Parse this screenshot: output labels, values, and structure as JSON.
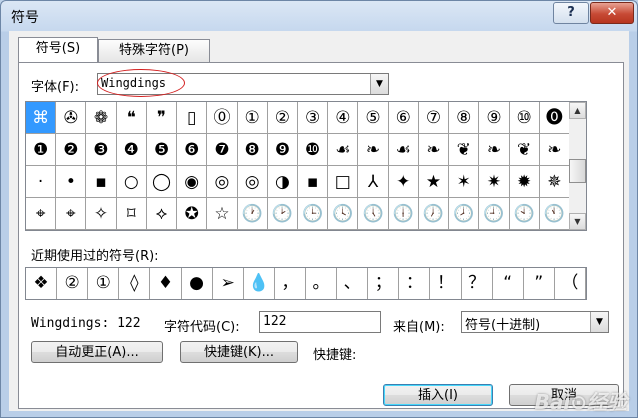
{
  "window": {
    "title": "符号",
    "help_label": "?",
    "close_label": "✕"
  },
  "tabs": [
    {
      "label": "符号(S)"
    },
    {
      "label": "特殊字符(P)"
    }
  ],
  "font_label": "字体(F):",
  "font_value": "Wingdings",
  "symbols": [
    "⌘",
    "✇",
    "❁",
    "❝",
    "❞",
    "▯",
    "⓪",
    "①",
    "②",
    "③",
    "④",
    "⑤",
    "⑥",
    "⑦",
    "⑧",
    "⑨",
    "⑩",
    "⓿",
    "❶",
    "❷",
    "❸",
    "❹",
    "❺",
    "❻",
    "❼",
    "❽",
    "❾",
    "❿",
    "☙",
    "❧",
    "☙",
    "❧",
    "❦",
    "❧",
    "❦",
    "❧",
    "·",
    "•",
    "▪",
    "○",
    "◯",
    "◉",
    "◎",
    "◎",
    "◑",
    "▪",
    "□",
    "⅄",
    "✦",
    "★",
    "✶",
    "✷",
    "✹",
    "✵",
    "⌖",
    "⌖",
    "✧",
    "⌑",
    "⟡",
    "✪",
    "☆",
    "🕐",
    "🕑",
    "🕒",
    "🕓",
    "🕔",
    "🕕",
    "🕖",
    "🕗",
    "🕘",
    "🕙",
    "🕚"
  ],
  "recent_label": "近期使用过的符号(R):",
  "recent": [
    "❖",
    "②",
    "①",
    "◊",
    "♦",
    "●",
    "➢",
    "💧",
    "，",
    "。",
    "、",
    "；",
    "：",
    "！",
    "？",
    "“",
    "”",
    "（"
  ],
  "status": {
    "font_code": "Wingdings: 122",
    "code_label": "字符代码(C):",
    "code_value": "122",
    "from_label": "来自(M):",
    "from_value": "符号(十进制)"
  },
  "buttons": {
    "autocorrect": "自动更正(A)...",
    "shortcut": "快捷键(K)...",
    "shortcut_label": "快捷键:",
    "insert": "插入(I)",
    "cancel": "取消"
  },
  "watermark": "Bai⊙经验"
}
